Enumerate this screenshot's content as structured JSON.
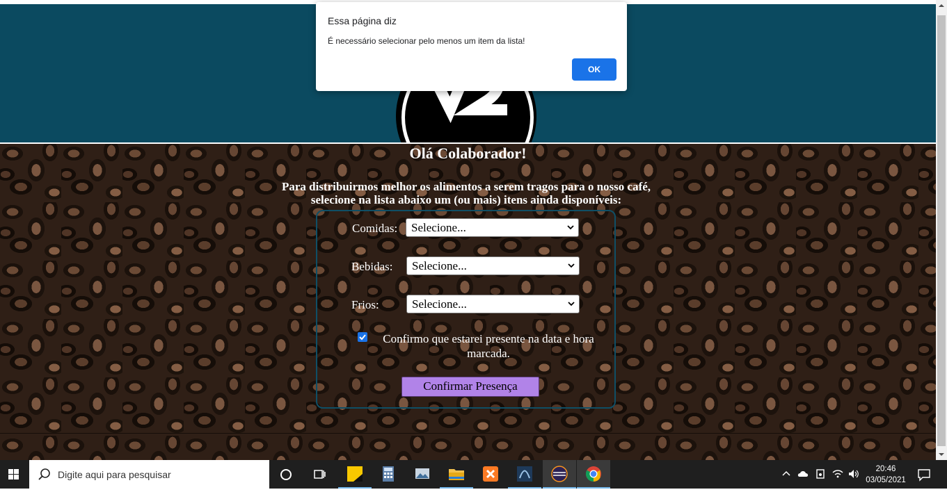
{
  "page": {
    "greeting": "Olá Colaborador!",
    "intro_line1": "Para distribuirmos melhor os alimentos a serem tragos para o nosso café,",
    "intro_line2": "selecione na lista abaixo um (ou mais) itens ainda disponíveis:",
    "logo_letters": "VZ"
  },
  "form": {
    "fields": [
      {
        "label": "Comidas:",
        "value": "Selecione..."
      },
      {
        "label": "Bebidas:",
        "value": "Selecione..."
      },
      {
        "label": "Frios:",
        "value": "Selecione..."
      }
    ],
    "confirm_checkbox": {
      "checked": true,
      "label_line1": "Confirmo que estarei presente na data e hora",
      "label_line2": "marcada."
    },
    "submit_label": "Confirmar Presença"
  },
  "alert": {
    "title": "Essa página diz",
    "message": "É necessário selecionar pelo menos um item da lista!",
    "ok_label": "OK"
  },
  "taskbar": {
    "search_placeholder": "Digite aqui para pesquisar",
    "apps": [
      "cortana-icon",
      "task-view-icon",
      "sticky-notes-icon",
      "calculator-icon",
      "photos-icon",
      "file-explorer-icon",
      "xampp-icon",
      "sql-developer-icon",
      "eclipse-icon",
      "chrome-icon"
    ],
    "time": "20:46",
    "date": "03/05/2021"
  },
  "colors": {
    "header": "#0b4a60",
    "form_border": "#0f4f66",
    "submit_button": "#b183e8",
    "alert_ok": "#1a73e8"
  }
}
